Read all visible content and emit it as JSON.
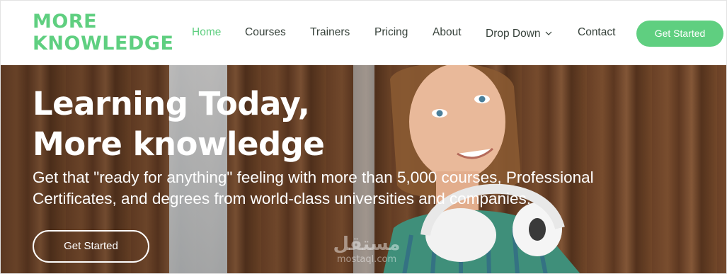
{
  "header": {
    "logo_line1": "MORE",
    "logo_line2": "KNOWLEDGE",
    "nav": [
      {
        "label": "Home",
        "active": true
      },
      {
        "label": "Courses"
      },
      {
        "label": "Trainers"
      },
      {
        "label": "Pricing"
      },
      {
        "label": "About"
      },
      {
        "label": "Drop Down",
        "icon": "chevron-down-icon"
      },
      {
        "label": "Contact"
      }
    ],
    "cta_label": "Get Started"
  },
  "hero": {
    "title_line1": "Learning Today,",
    "title_line2": "More knowledge",
    "subtitle": "Get that \"ready for anything\" feeling with more than 5,000 courses, Professional Certificates, and degrees from world-class universities and companies.",
    "cta_label": "Get Started"
  },
  "watermark": {
    "logo_text": "مستقل",
    "text": "mostaql.com"
  },
  "colors": {
    "accent": "#5fcf80",
    "nav_text": "#37423b",
    "white": "#ffffff"
  }
}
